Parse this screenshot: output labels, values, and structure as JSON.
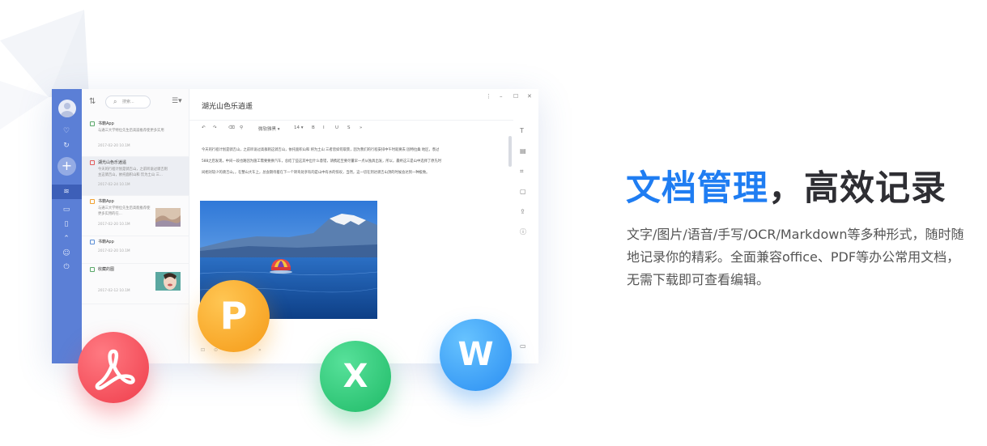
{
  "headline": {
    "part1": "文档管理",
    "part2": "，高效记录"
  },
  "subtext": "文字/图片/语音/手写/OCR/Markdown等多种形式，随时随地记录你的精彩。全面兼容office、PDF等办公常用文档，无需下载即可查看编辑。",
  "app": {
    "search_placeholder": "搜索...",
    "doc_title": "湖光山色乐逍遥",
    "toolbar": {
      "undo": "↶",
      "redo": "↷",
      "style_select": "微软雅黑",
      "font_size": "14",
      "bold": "B",
      "italic": "I",
      "underline": "U",
      "strike": "S",
      "more": "»"
    },
    "paragraph": "今天的行程计划是骑吉山，之前听说过高群则这骑吉山，依托面积山和 将为土山 三者皆如何取景，因为我们的行程安排中午时就要去 固特拉桑 地区，羡过588之后发现，中间一段也路因为施工需要要换汽车，总结了些这其中出什么意错，请携起至要尽量早一点从独具出发，所以，最终这三是山中选择了原先时间相对较少的骑吉山，，在整山大车上，总会期待着在下一个转弯处享有的是山中有水的惊叹，当然，这一切在到达骑吉山顶的时候会达到一种极致。",
    "notes": [
      {
        "title": "书籍App",
        "desc": "与通三大学特位先生后高崩推荐使更多实用",
        "date": "2017-02-20",
        "size": "10.1M"
      },
      {
        "title": "湖光山色乐逍遥",
        "desc": "今天的行程计划是骑吉山，之前听说过骑吉则主这骑吉山，依托面积山和 饮为土山 三...",
        "date": "2017-02-24",
        "size": "10.1M"
      },
      {
        "title": "书籍App",
        "desc": "与通三大学特位先生后高能推荐使更多实用的在...",
        "date": "2017-02-20",
        "size": "10.1M"
      },
      {
        "title": "书籍App",
        "desc": "",
        "date": "2017-02-20",
        "size": "10.1M"
      },
      {
        "title": "收藏的图",
        "desc": "",
        "date": "2017-02-12",
        "size": "10.1M"
      }
    ]
  },
  "bubbles": {
    "pdf": "pdf-icon",
    "p": "P",
    "x": "X",
    "w": "W"
  },
  "colors": {
    "accent": "#1f7df2",
    "rail": "#5b7fd6",
    "pdf": "#ef3d4b",
    "ppt": "#f59a17",
    "xls": "#1fba67",
    "doc": "#2a8ef2"
  }
}
